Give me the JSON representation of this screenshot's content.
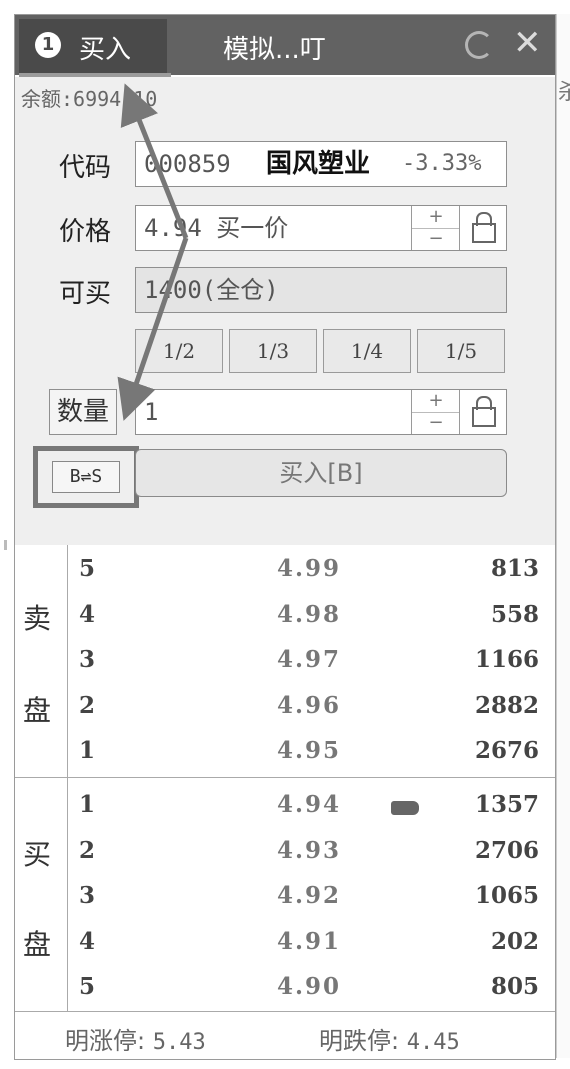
{
  "titlebar": {
    "tab_number": "1",
    "tab_label": "买入",
    "title": "模拟...叮",
    "icons": [
      "refresh-icon",
      "close-icon"
    ]
  },
  "account": {
    "balance_text": "余额:6994.10"
  },
  "form": {
    "code_label": "代码",
    "code_value": "000859",
    "stock_name": "国风塑业",
    "change_pct": "-3.33%",
    "price_label": "价格",
    "price_value": "4.94 买一价",
    "max_label": "可买",
    "max_value": "1400(全仓)",
    "fractions": [
      "1/2",
      "1/3",
      "1/4",
      "1/5"
    ],
    "qty_label": "数量",
    "qty_value": "1",
    "stepper_plus": "+",
    "stepper_minus": "−",
    "swap_label": "B⇌S",
    "buy_button": "买入[B]"
  },
  "orderbook": {
    "sell_label": [
      "卖",
      "盘"
    ],
    "buy_label": [
      "买",
      "盘"
    ],
    "sell": [
      {
        "level": "5",
        "price": "4.99",
        "volume": "813"
      },
      {
        "level": "4",
        "price": "4.98",
        "volume": "558"
      },
      {
        "level": "3",
        "price": "4.97",
        "volume": "1166"
      },
      {
        "level": "2",
        "price": "4.96",
        "volume": "2882"
      },
      {
        "level": "1",
        "price": "4.95",
        "volume": "2676"
      }
    ],
    "buy": [
      {
        "level": "1",
        "price": "4.94",
        "volume": "1357"
      },
      {
        "level": "2",
        "price": "4.93",
        "volume": "2706"
      },
      {
        "level": "3",
        "price": "4.92",
        "volume": "1065"
      },
      {
        "level": "4",
        "price": "4.91",
        "volume": "202"
      },
      {
        "level": "5",
        "price": "4.90",
        "volume": "805"
      }
    ]
  },
  "footer": {
    "limit_up_label": "明涨停:",
    "limit_up_value": "5.43",
    "limit_down_label": "明跌停:",
    "limit_down_value": "4.45"
  },
  "right_edge_text": "杀",
  "colors": {
    "titlebar": "#626262",
    "tab_active": "#4a4a4a",
    "annotation": "#777777"
  }
}
